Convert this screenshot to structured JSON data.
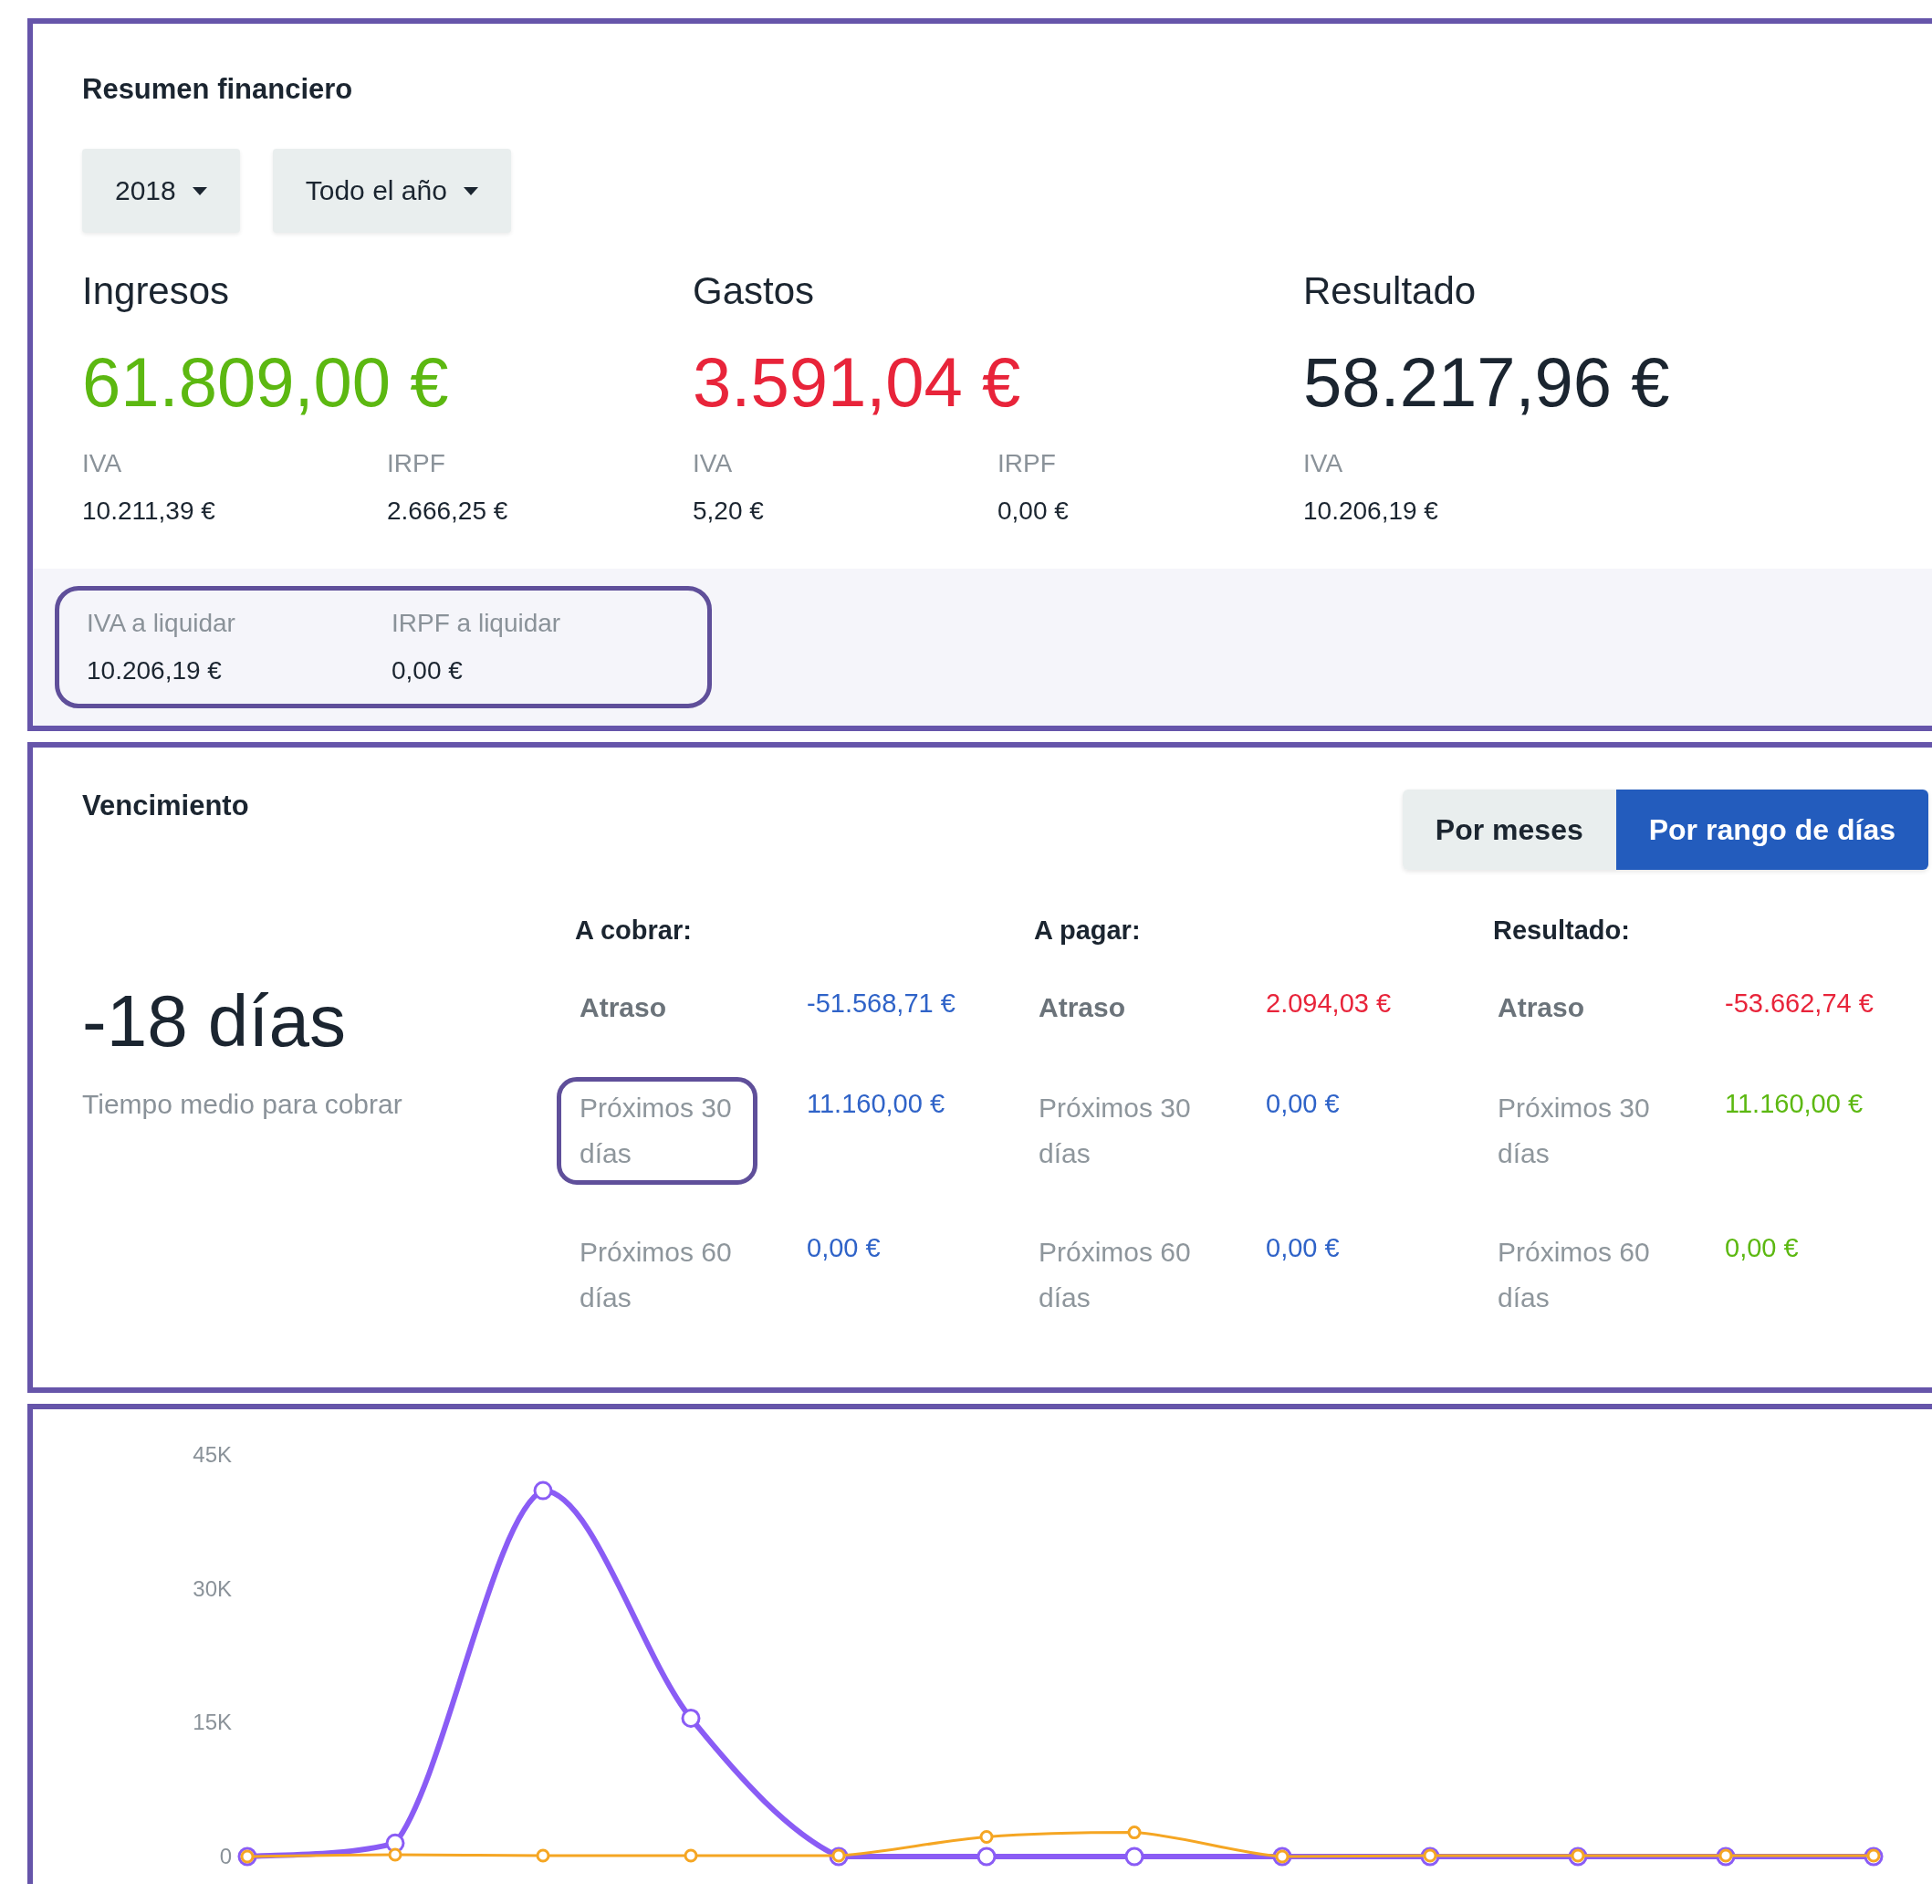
{
  "summary": {
    "title": "Resumen financiero",
    "filters": [
      {
        "label": "2018"
      },
      {
        "label": "Todo el año"
      }
    ],
    "totals": [
      {
        "heading": "Ingresos",
        "amount": "61.809,00 €",
        "color": "#5cb811",
        "details": [
          {
            "label": "IVA",
            "value": "10.211,39 €"
          },
          {
            "label": "IRPF",
            "value": "2.666,25 €"
          }
        ]
      },
      {
        "heading": "Gastos",
        "amount": "3.591,04 €",
        "color": "#e8243a",
        "details": [
          {
            "label": "IVA",
            "value": "5,20 €"
          },
          {
            "label": "IRPF",
            "value": "0,00 €"
          }
        ]
      },
      {
        "heading": "Resultado",
        "amount": "58.217,96 €",
        "color": "#1b2530",
        "details": [
          {
            "label": "IVA",
            "value": "10.206,19 €"
          }
        ]
      }
    ],
    "settlement": {
      "highlighted": true,
      "items": [
        {
          "label": "IVA a liquidar",
          "value": "10.206,19 €"
        },
        {
          "label": "IRPF a liquidar",
          "value": "0,00 €"
        }
      ]
    }
  },
  "maturity": {
    "title": "Vencimiento",
    "views": [
      {
        "label": "Por meses",
        "selected": false
      },
      {
        "label": "Por rango de días",
        "selected": true
      }
    ],
    "average": {
      "value": "-18 días",
      "caption": "Tiempo medio para cobrar"
    },
    "groups": [
      {
        "heading": "A cobrar:",
        "rows": [
          {
            "kind": "overdue",
            "label": "Atraso",
            "value": "-51.568,71 €",
            "color": "#2f63c8",
            "highlighted": false
          },
          {
            "kind": "upcoming",
            "label": "Próximos 30 días",
            "value": "11.160,00 €",
            "color": "#2f63c8",
            "highlighted": true
          },
          {
            "kind": "upcoming",
            "label": "Próximos 60 días",
            "value": "0,00 €",
            "color": "#2f63c8",
            "highlighted": false
          }
        ]
      },
      {
        "heading": "A pagar:",
        "rows": [
          {
            "kind": "overdue",
            "label": "Atraso",
            "value": "2.094,03 €",
            "color": "#e8243a",
            "highlighted": false
          },
          {
            "kind": "upcoming",
            "label": "Próximos 30 días",
            "value": "0,00 €",
            "color": "#2f63c8",
            "highlighted": false
          },
          {
            "kind": "upcoming",
            "label": "Próximos 60 días",
            "value": "0,00 €",
            "color": "#2f63c8",
            "highlighted": false
          }
        ]
      },
      {
        "heading": "Resultado:",
        "rows": [
          {
            "kind": "overdue",
            "label": "Atraso",
            "value": "-53.662,74 €",
            "color": "#e8243a",
            "highlighted": false
          },
          {
            "kind": "upcoming",
            "label": "Próximos 30 días",
            "value": "11.160,00 €",
            "color": "#5cb811",
            "highlighted": false
          },
          {
            "kind": "upcoming",
            "label": "Próximos 60 días",
            "value": "0,00 €",
            "color": "#5cb811",
            "highlighted": false
          }
        ]
      }
    ]
  },
  "chart": {
    "chart_data": {
      "type": "line",
      "ylim": [
        0,
        45000
      ],
      "yticks": [
        {
          "value": 0,
          "label": "0"
        },
        {
          "value": 15000,
          "label": "15K"
        },
        {
          "value": 30000,
          "label": "30K"
        },
        {
          "value": 45000,
          "label": "45K"
        }
      ],
      "series": [
        {
          "color": "#8a5cf5",
          "marker": "circle",
          "values": [
            0,
            1500,
            41000,
            15500,
            0,
            0,
            0,
            0,
            0,
            0,
            0,
            0
          ]
        },
        {
          "color": "#f5a623",
          "marker": "circle",
          "values": [
            0,
            200,
            100,
            100,
            100,
            2200,
            2700,
            0,
            100,
            100,
            100,
            100
          ]
        }
      ]
    }
  }
}
